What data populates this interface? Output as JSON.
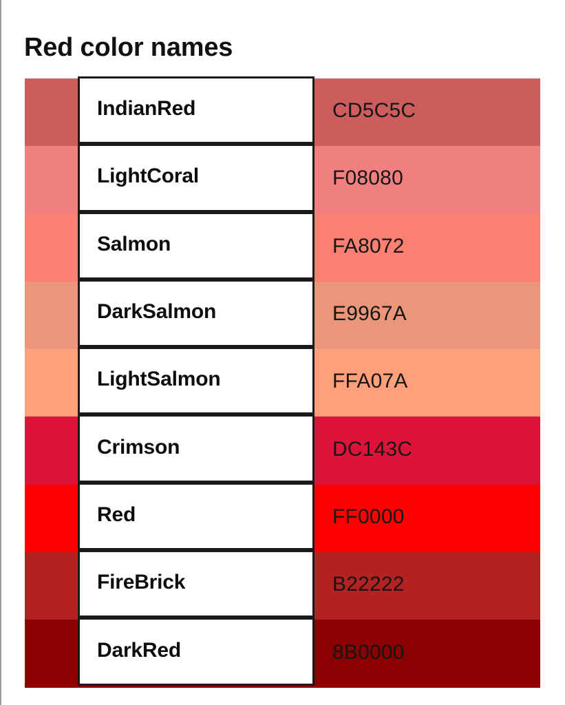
{
  "page": {
    "title": "Red color names",
    "background_color": "#FFFFFF",
    "text_color": "#111111",
    "border_color": "#1A1A1A"
  },
  "table": {
    "columns": [
      "swatch",
      "name",
      "hex"
    ],
    "rows": [
      {
        "name": "IndianRed",
        "hex": "CD5C5C",
        "swatch": "#CD5C5C"
      },
      {
        "name": "LightCoral",
        "hex": "F08080",
        "swatch": "#F08080"
      },
      {
        "name": "Salmon",
        "hex": "FA8072",
        "swatch": "#FA8072"
      },
      {
        "name": "DarkSalmon",
        "hex": "E9967A",
        "swatch": "#E9967A"
      },
      {
        "name": "LightSalmon",
        "hex": "FFA07A",
        "swatch": "#FFA07A"
      },
      {
        "name": "Crimson",
        "hex": "DC143C",
        "swatch": "#DC143C"
      },
      {
        "name": "Red",
        "hex": "FF0000",
        "swatch": "#FF0000"
      },
      {
        "name": "FireBrick",
        "hex": "B22222",
        "swatch": "#B22222"
      },
      {
        "name": "DarkRed",
        "hex": "8B0000",
        "swatch": "#8B0000"
      }
    ]
  }
}
